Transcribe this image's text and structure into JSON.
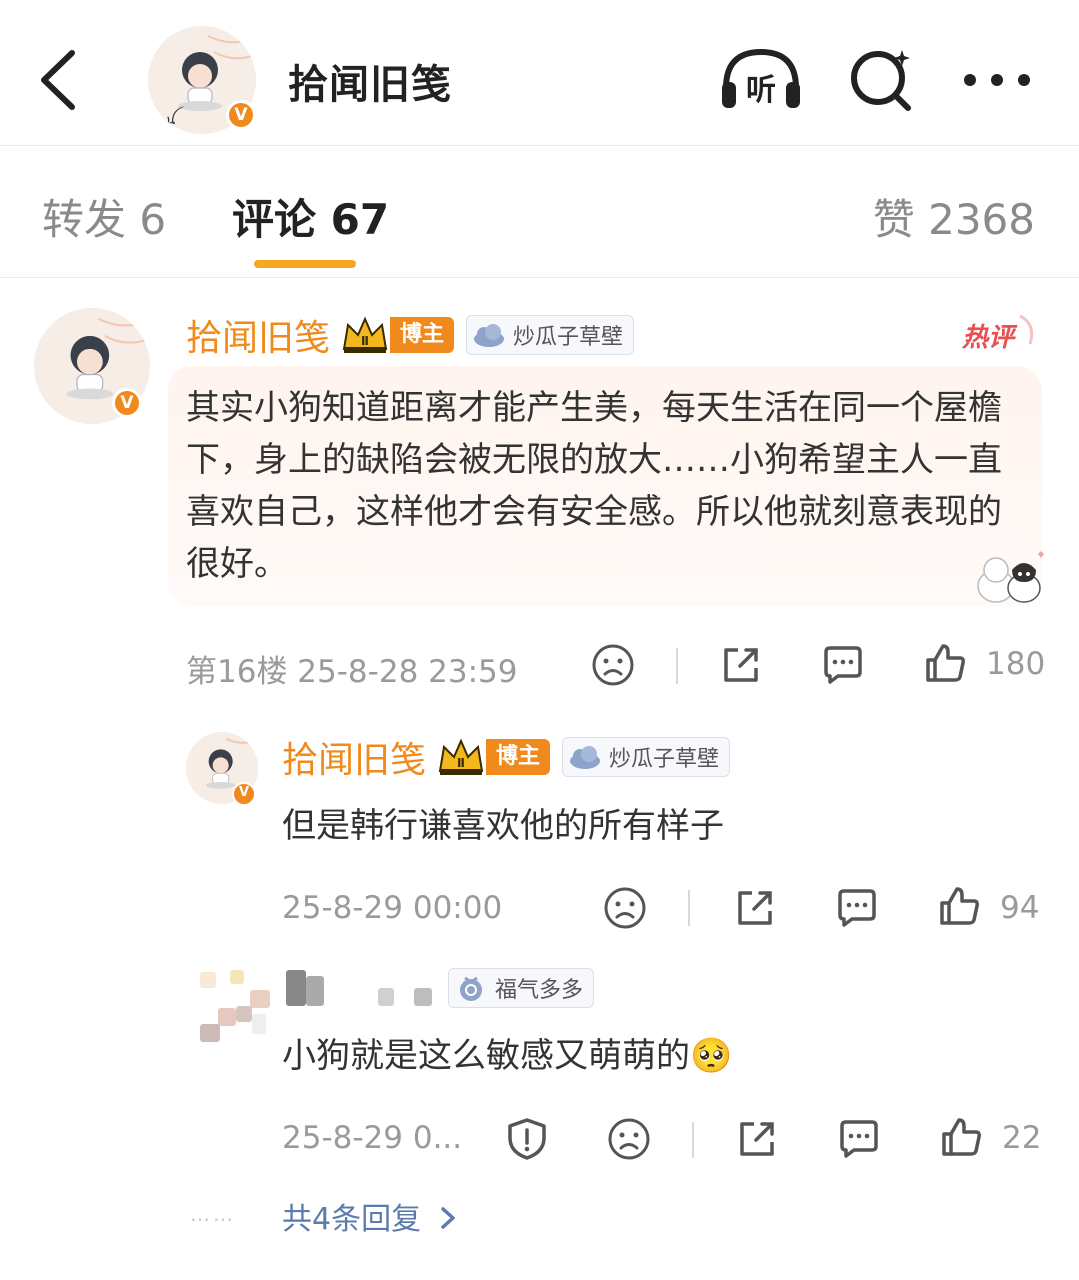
{
  "header": {
    "title": "拾闻旧笺",
    "verified_mark": "V",
    "listen_label": "听"
  },
  "tabs": {
    "repost": "转发 6",
    "comment": "评论 67",
    "like": "赞 2368"
  },
  "comments": [
    {
      "username": "拾闻旧笺",
      "crown_level": "Ⅱ",
      "role_badge": "博主",
      "tag": "炒瓜子草壁",
      "hot_label": "热评",
      "text": "其实小狗知道距离才能产生美，每天生活在同一个屋檐下，身上的缺陷会被无限的放大……小狗希望主人一直喜欢自己，这样他才会有安全感。所以他就刻意表现的很好。",
      "floor_time": "第16楼 25-8-28 23:59",
      "likes": "180"
    },
    {
      "username": "拾闻旧笺",
      "crown_level": "Ⅱ",
      "role_badge": "博主",
      "tag": "炒瓜子草壁",
      "text": "但是韩行谦喜欢他的所有样子",
      "time": "25-8-29 00:00",
      "likes": "94"
    },
    {
      "tag": "福气多多",
      "text": "小狗就是这么敏感又萌萌的",
      "emoji": "🥺",
      "time": "25-8-29 0...",
      "likes": "22"
    }
  ],
  "more_replies": "共4条回复",
  "more_dots": "……",
  "colors": {
    "accent": "#f08a1c",
    "tab_indicator": "#f5a623",
    "link": "#5b7bad"
  },
  "icons": [
    "back-arrow-icon",
    "headphones-icon",
    "search-icon",
    "more-icon",
    "crown-icon",
    "dislike-face-icon",
    "share-icon",
    "reply-icon",
    "thumbs-up-icon",
    "report-icon",
    "chevron-right-icon"
  ]
}
